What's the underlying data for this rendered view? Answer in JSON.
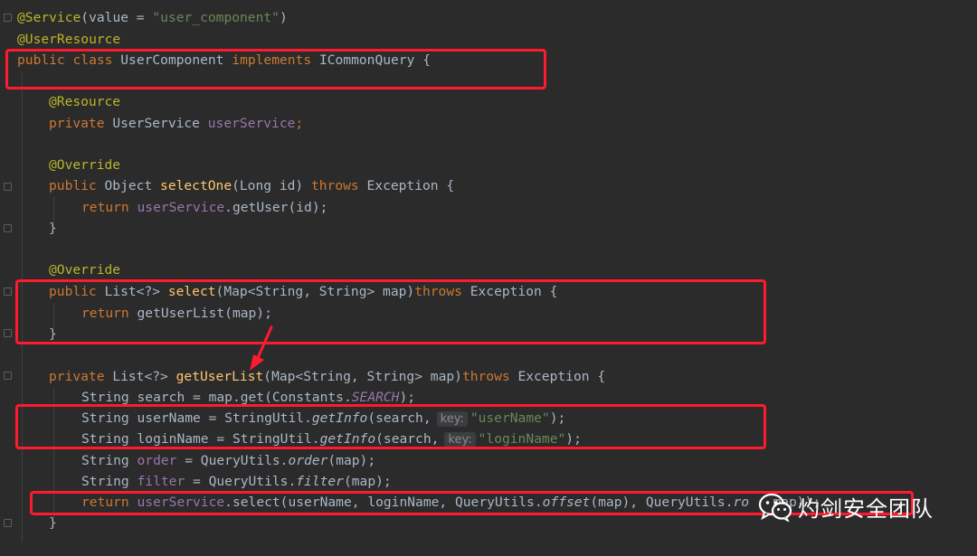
{
  "code": {
    "service_annotation": "@Service",
    "service_args": "(value = ",
    "service_value": "\"user_component\"",
    "service_close": ")",
    "userresource_annotation": "@UserResource",
    "kw_public": "public",
    "kw_class": "class",
    "class_name": "UserComponent",
    "kw_implements": "implements",
    "interface_name": "ICommonQuery",
    "open_brace": "{",
    "close_brace": "}",
    "resource_annotation": "@Resource",
    "kw_private": "private",
    "user_service_type": "UserService",
    "user_service_field": "userService",
    "semicolon": ";",
    "override_annotation": "@Override",
    "object_type": "Object",
    "select_one_fn": "selectOne",
    "select_one_params": "(Long id)",
    "kw_throws": "throws",
    "exception_type": "Exception",
    "kw_return": "return",
    "get_user_call": ".getUser(id);",
    "list_type": "List<?>",
    "select_fn": "select",
    "select_params": "(Map<String, String> map)",
    "get_user_list_call": "getUserList(map);",
    "get_user_list_fn": "getUserList",
    "string_type": "String",
    "search_decl": "search = map.get(Constants.",
    "search_const": "SEARCH",
    "search_end": ");",
    "username_decl": "userName = StringUtil.",
    "loginname_decl": "loginName = StringUtil.",
    "get_info_fn": "getInfo",
    "search_arg": "(search,",
    "hint_key": "key:",
    "username_key": "\"userName\"",
    "loginname_key": "\"loginName\"",
    "order_var": "order",
    "filter_var": "filter",
    "assign_query_utils": " = QueryUtils.",
    "order_fn": "order",
    "filter_fn": "filter",
    "map_arg_end": "(map);",
    "return_select_call": ".select(userName, loginName, QueryUtils.",
    "offset_fn": "offset",
    "offset_args": "(map), QueryUtils.",
    "rows_fn_partial": "ro",
    "rows_args_partial": "map));"
  },
  "watermark": {
    "text": "灼剑安全团队",
    "icon": "wechat-icon"
  },
  "colors": {
    "background": "#2b2b2b",
    "keyword": "#cc7832",
    "annotation": "#bbb529",
    "string": "#6a8759",
    "field": "#9876aa",
    "function": "#ffc66d",
    "text": "#a9b7c6",
    "highlight_box": "#ff1a2e"
  }
}
